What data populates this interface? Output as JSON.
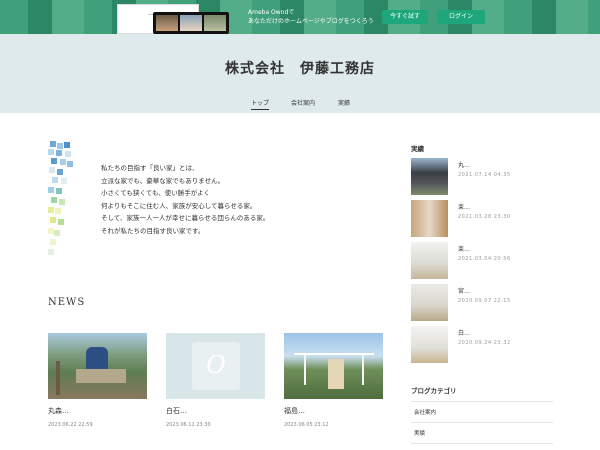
{
  "promo": {
    "line1": "Ameba Owndで",
    "line2": "あなただけのホームページやブログをつくろう",
    "try_label": "今すぐ試す",
    "login_label": "ログイン",
    "accent": "#1ea77a"
  },
  "header": {
    "site_title": "株式会社　伊藤工務店",
    "nav": [
      {
        "label": "トップ",
        "active": true
      },
      {
        "label": "会社案内",
        "active": false
      },
      {
        "label": "実績",
        "active": false
      }
    ],
    "background": "#dfeaed"
  },
  "intro": {
    "lines": [
      "私たちの目指す「良い家」とは、",
      "立派な家でも、豪華な家でもありません。",
      "小さくても狭くても、使い勝手がよく",
      "何よりもそこに住む人、家族が安心して暮らせる家。",
      "そして、家族一人一人が幸せに暮らせる団らんのある家。",
      "それが私たちの目指す良い家です。"
    ]
  },
  "news": {
    "heading": "NEWS",
    "cards": [
      {
        "title": "丸森…",
        "date": "2023.06.22 22:59"
      },
      {
        "title": "白石…",
        "date": "2023.06.11 23:30",
        "placeholder_glyph": "O"
      },
      {
        "title": "福島…",
        "date": "2023.06.05 23:12"
      }
    ]
  },
  "sidebar": {
    "works_heading": "実績",
    "posts": [
      {
        "title": "丸…",
        "date": "2021.07.14 04:35"
      },
      {
        "title": "束…",
        "date": "2021.03.28 23:30"
      },
      {
        "title": "束…",
        "date": "2021.03.04 20:56"
      },
      {
        "title": "宮…",
        "date": "2020.09.07 22:15"
      },
      {
        "title": "白…",
        "date": "2020.09.24 23:32"
      }
    ],
    "category_heading": "ブログカテゴリ",
    "categories": [
      "会社案内",
      "実績"
    ]
  }
}
